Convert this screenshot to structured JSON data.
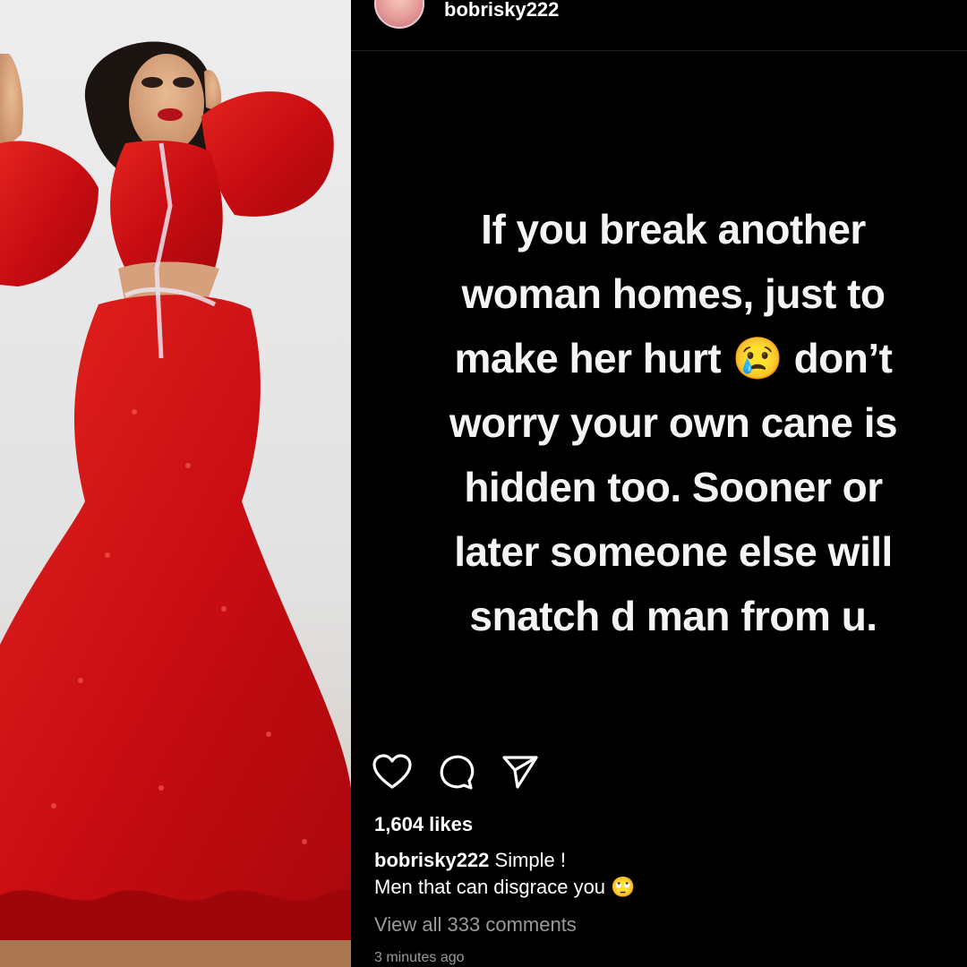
{
  "header": {
    "username": "bobrisky222"
  },
  "post": {
    "quote_lines": [
      "If you break another",
      "woman homes, just to",
      "make her hurt 😢 don’t",
      "worry your own cane is",
      "hidden too. Sooner or",
      "later someone else will",
      "snatch d man from u."
    ]
  },
  "actions": {
    "like_icon": "heart-icon",
    "comment_icon": "comment-icon",
    "share_icon": "send-icon"
  },
  "likes": "1,604 likes",
  "caption": {
    "username": "bobrisky222",
    "line1": "Simple !",
    "line2": "Men that can disgrace you 🙄"
  },
  "view_comments": "View all 333 comments",
  "timestamp": "3 minutes ago",
  "colors": {
    "background": "#000000",
    "dress": "#d10f14",
    "muted_text": "#9a9a9a"
  }
}
